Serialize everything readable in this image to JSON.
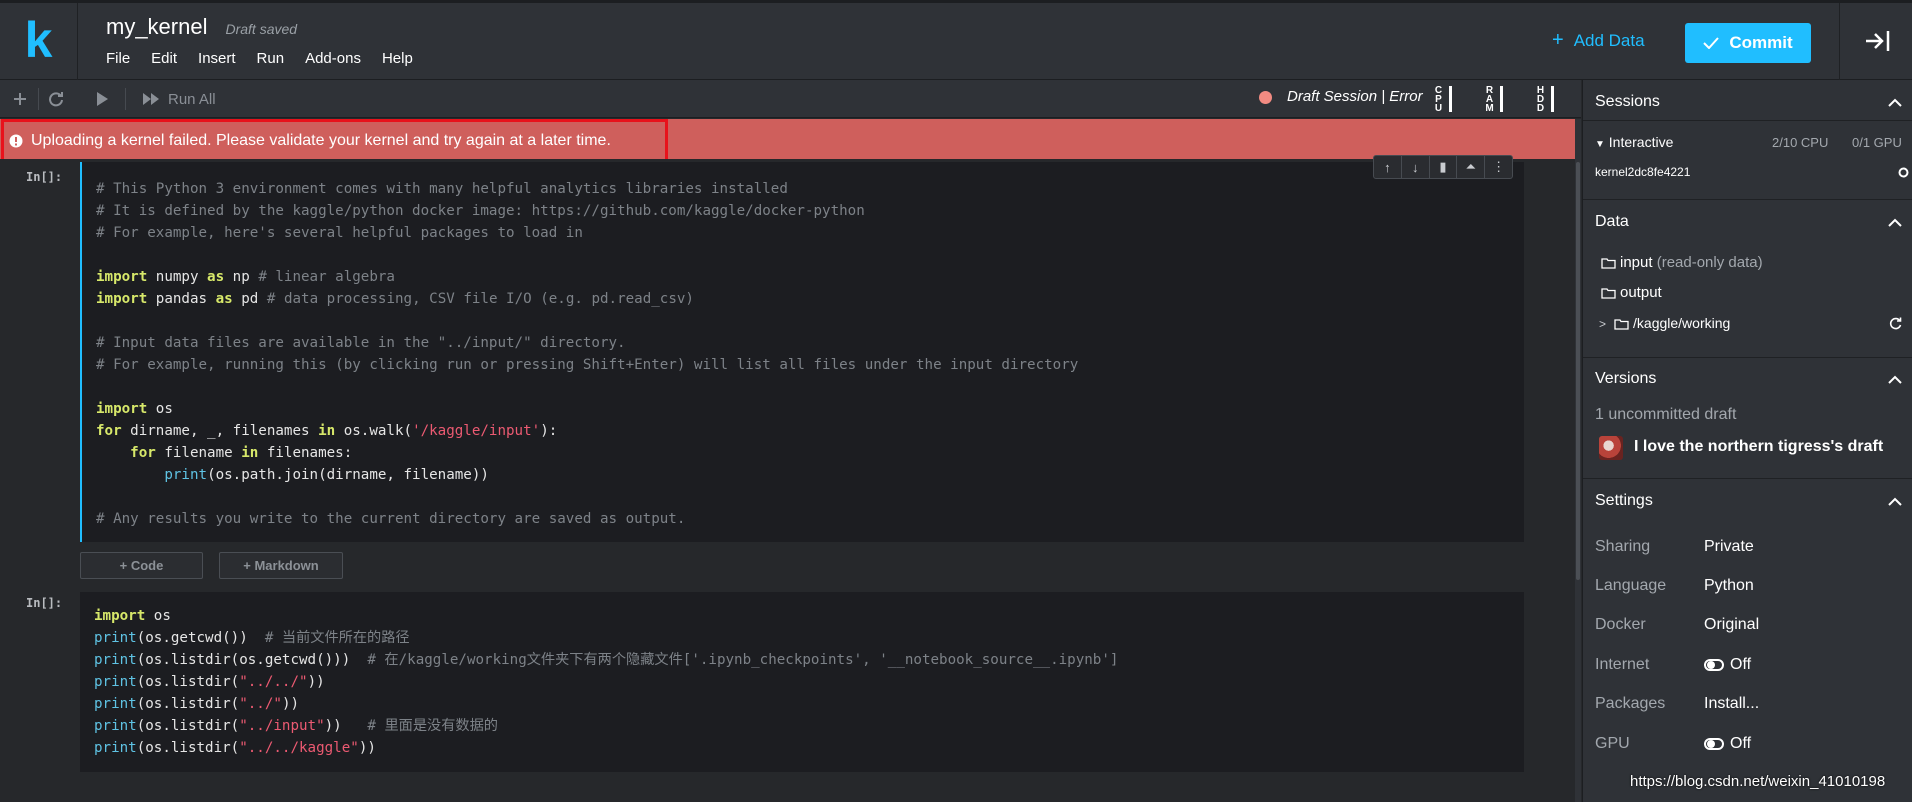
{
  "header": {
    "logo": "k",
    "title": "my_kernel",
    "save_status": "Draft saved",
    "menu": [
      "File",
      "Edit",
      "Insert",
      "Run",
      "Add-ons",
      "Help"
    ],
    "add_data_label": "Add Data",
    "commit_label": "Commit"
  },
  "toolbar": {
    "run_all_label": "Run All",
    "session_status": "Draft Session | Error",
    "meters": [
      "CPU",
      "RAM",
      "HDD"
    ]
  },
  "error_banner": {
    "message": "Uploading a kernel failed. Please validate your kernel and try again at a later time."
  },
  "cells": {
    "prompt": "In[]:",
    "cell1_lines": [
      "# This Python 3 environment comes with many helpful analytics libraries installed",
      "# It is defined by the kaggle/python docker image: https://github.com/kaggle/docker-python",
      "# For example, here's several helpful packages to load in",
      "",
      "import numpy as np # linear algebra",
      "import pandas as pd # data processing, CSV file I/O (e.g. pd.read_csv)",
      "",
      "# Input data files are available in the \"../input/\" directory.",
      "# For example, running this (by clicking run or pressing Shift+Enter) will list all files under the input directory",
      "",
      "import os",
      "for dirname, _, filenames in os.walk('/kaggle/input'):",
      "    for filename in filenames:",
      "        print(os.path.join(dirname, filename))",
      "",
      "# Any results you write to the current directory are saved as output."
    ],
    "cell2_lines": [
      "import os",
      "print(os.getcwd())  # 当前文件所在的路径",
      "print(os.listdir(os.getcwd()))  # 在/kaggle/working文件夹下有两个隐藏文件['.ipynb_checkpoints', '__notebook_source__.ipynb']",
      "print(os.listdir(\"../../\"))",
      "print(os.listdir(\"../\"))",
      "print(os.listdir(\"../input\"))   # 里面是没有数据的",
      "print(os.listdir(\"../../kaggle\"))"
    ],
    "add_code_label": "+ Code",
    "add_markdown_label": "+ Markdown"
  },
  "sidebar": {
    "sessions": {
      "title": "Sessions",
      "session_type": "Interactive",
      "cpu": "2/10 CPU",
      "gpu": "0/1 GPU",
      "kernel_id": "kernel2dc8fe4221"
    },
    "data": {
      "title": "Data",
      "input_label": "input",
      "input_note": "(read-only data)",
      "output_label": "output",
      "working_label": "/kaggle/working"
    },
    "versions": {
      "title": "Versions",
      "uncommitted": "1 uncommitted draft",
      "draft_name": "I love the northern tigress's draft"
    },
    "settings": {
      "title": "Settings",
      "sharing_label": "Sharing",
      "sharing_value": "Private",
      "language_label": "Language",
      "language_value": "Python",
      "docker_label": "Docker",
      "docker_value": "Original",
      "internet_label": "Internet",
      "internet_value": "Off",
      "packages_label": "Packages",
      "packages_value": "Install...",
      "gpu_label": "GPU",
      "gpu_value": "Off"
    }
  },
  "watermark": "https://blog.csdn.net/weixin_41010198"
}
